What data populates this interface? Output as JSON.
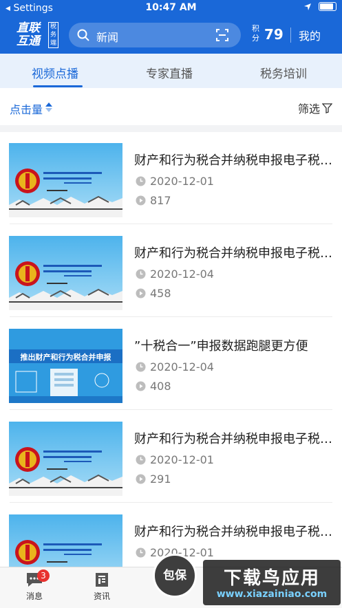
{
  "status_bar": {
    "left": "◂ Settings",
    "time": "10:47 AM"
  },
  "header": {
    "logo_main": "直联\n互通",
    "logo_side": "税务端",
    "search_placeholder": "新闻",
    "points_label": "积分",
    "points_value": "79",
    "mine_label": "我的"
  },
  "tabs": [
    {
      "label": "视频点播",
      "active": true
    },
    {
      "label": "专家直播",
      "active": false
    },
    {
      "label": "税务培训",
      "active": false
    }
  ],
  "filter_bar": {
    "sort_label": "点击量",
    "filter_label": "筛选"
  },
  "videos": [
    {
      "title": "财产和行为税合并纳税申报电子税务局操作",
      "date": "2020-12-01",
      "views": "817",
      "thumb": "emblem"
    },
    {
      "title": "财产和行为税合并纳税申报电子税务局操作",
      "date": "2020-12-04",
      "views": "458",
      "thumb": "emblem"
    },
    {
      "title": "”十税合一”申报数据跑腿更方便",
      "date": "2020-12-04",
      "views": "408",
      "thumb": "banner",
      "thumb_text": "推出财产和行为税合并申报"
    },
    {
      "title": "财产和行为税合并纳税申报电子税务局操作",
      "date": "2020-12-01",
      "views": "291",
      "thumb": "emblem"
    },
    {
      "title": "财产和行为税合并纳税申报电子税务局操作",
      "date": "2020-12-01",
      "views": "",
      "thumb": "emblem"
    }
  ],
  "bottom_tabs": [
    {
      "label": "消息",
      "badge": "3",
      "icon": "message-icon"
    },
    {
      "label": "资讯",
      "icon": "news-icon"
    }
  ],
  "center_button": "包保",
  "watermark": {
    "line1": "下载鸟应用",
    "line2": "www.xiazainiao.com"
  },
  "colors": {
    "brand": "#1a68d8",
    "tab_bg": "#e8f1fc",
    "badge": "#e8322f"
  }
}
